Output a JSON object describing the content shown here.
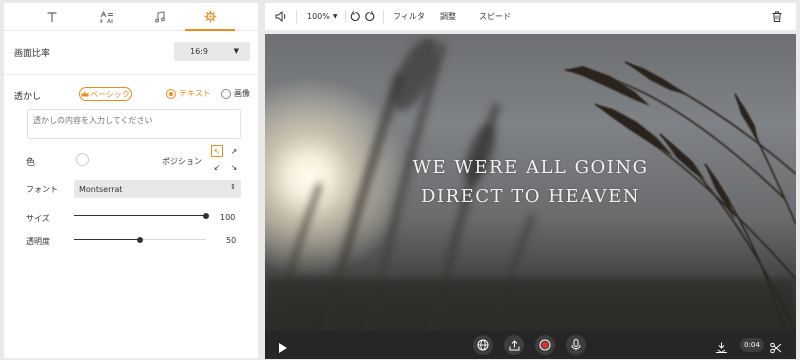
{
  "sidebar": {
    "tabs": [
      {
        "name": "text-icon",
        "glyph": "T"
      },
      {
        "name": "font-style-icon",
        "glyph": "A"
      },
      {
        "name": "music-icon",
        "glyph": "♫"
      },
      {
        "name": "gear-icon",
        "glyph": "⚙"
      }
    ],
    "active_tab": 3,
    "aspect": {
      "label": "画面比率",
      "value": "16:9"
    },
    "watermark": {
      "label": "透かし",
      "basic_label": "ベーシック",
      "text_option": "テキスト",
      "image_option": "画像",
      "selected": "text",
      "placeholder": "透かしの内容を入力してください"
    },
    "color": {
      "label": "色",
      "value": "#ffffff"
    },
    "position": {
      "label": "ポジション",
      "selected": "top-left"
    },
    "font": {
      "label": "フォント",
      "value": "Montserrat"
    },
    "size": {
      "label": "サイズ",
      "value": 100
    },
    "opacity": {
      "label": "透明度",
      "value": 50
    }
  },
  "toolbar": {
    "zoom": "100%",
    "filter_label": "フィルタ",
    "adjust_label": "調整",
    "speed_label": "スピード"
  },
  "preview": {
    "watermark_line1": "WE WERE ALL GOING",
    "watermark_line2": "DIRECT TO HEAVEN"
  },
  "playbar": {
    "time": "0:04"
  },
  "colors": {
    "accent": "#f08a1c",
    "record": "#e0312b",
    "playbar_bg": "#262626"
  }
}
